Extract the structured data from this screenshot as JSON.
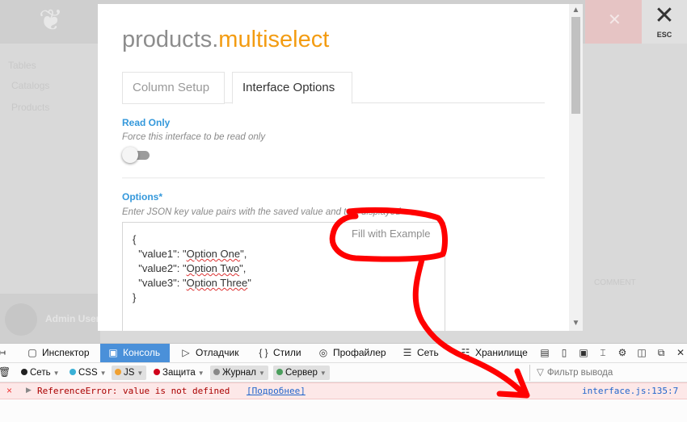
{
  "background_app": {
    "logo_glyph": "❦",
    "close_glyph": "✕",
    "esc_icon_glyph": "✕",
    "esc_label": "ESC",
    "nav_items": [
      "Tables",
      "Catalogs",
      "Products"
    ],
    "right_text": "COMMENT",
    "user_name": "Admin User"
  },
  "modal": {
    "title_prefix": "products.",
    "title_accent": "multiselect",
    "accent_color": "#f39c12",
    "tabs": [
      {
        "label": "Column Setup",
        "active": false
      },
      {
        "label": "Interface Options",
        "active": true
      }
    ],
    "read_only": {
      "label": "Read Only",
      "help": "Force this interface to be read only",
      "enabled": false
    },
    "options": {
      "label": "Options",
      "required_mark": "*",
      "help": "Enter JSON key value pairs with the saved value and text displayed",
      "fill_button": "Fill with Example",
      "code_lines": [
        {
          "pre": "{",
          "squiggle": "",
          "post": ""
        },
        {
          "pre": "  \"value1\": \"",
          "squiggle": "Option One",
          "post": "\","
        },
        {
          "pre": "  \"value2\": \"",
          "squiggle": "Option Two",
          "post": "\","
        },
        {
          "pre": "  \"value3\": \"",
          "squiggle": "Option Three",
          "post": "\""
        },
        {
          "pre": "}",
          "squiggle": "",
          "post": ""
        }
      ]
    },
    "scroll_up_icon": "▲",
    "scroll_down_icon": "▼"
  },
  "devtools": {
    "tabs": [
      {
        "icon": "↤",
        "label": ""
      },
      {
        "icon": "▢",
        "label": "Инспектор"
      },
      {
        "icon": "▣",
        "label": "Консоль",
        "active": true
      },
      {
        "icon": "▷",
        "label": "Отладчик"
      },
      {
        "icon": "{ }",
        "label": "Стили"
      },
      {
        "icon": "◎",
        "label": "Профайлер"
      },
      {
        "icon": "☰",
        "label": "Сеть"
      },
      {
        "icon": "☷",
        "label": "Хранилище"
      }
    ],
    "tools": [
      "▤",
      "▯",
      "▣",
      "⌶",
      "⚙",
      "◫",
      "⧉",
      "✕"
    ],
    "trash_icon": "🗑",
    "filters": [
      {
        "label": "Сеть",
        "color": "#222222",
        "active": false
      },
      {
        "label": "CSS",
        "color": "#3ab0d6",
        "active": false
      },
      {
        "label": "JS",
        "color": "#f0a030",
        "active": true
      },
      {
        "label": "Защита",
        "color": "#d0021b",
        "active": false
      },
      {
        "label": "Журнал",
        "color": "#888888",
        "active": true
      },
      {
        "label": "Сервер",
        "color": "#4a9e5c",
        "active": true
      }
    ],
    "filter_output": {
      "icon": "▽",
      "placeholder": "Фильтр вывода"
    },
    "error": {
      "icon": "×",
      "expand_icon": "▶",
      "message": "ReferenceError: value is not defined",
      "more_link": "[Подробнее]",
      "source": "interface.js:135:7"
    }
  },
  "annotation": {
    "color": "#ff0000"
  }
}
